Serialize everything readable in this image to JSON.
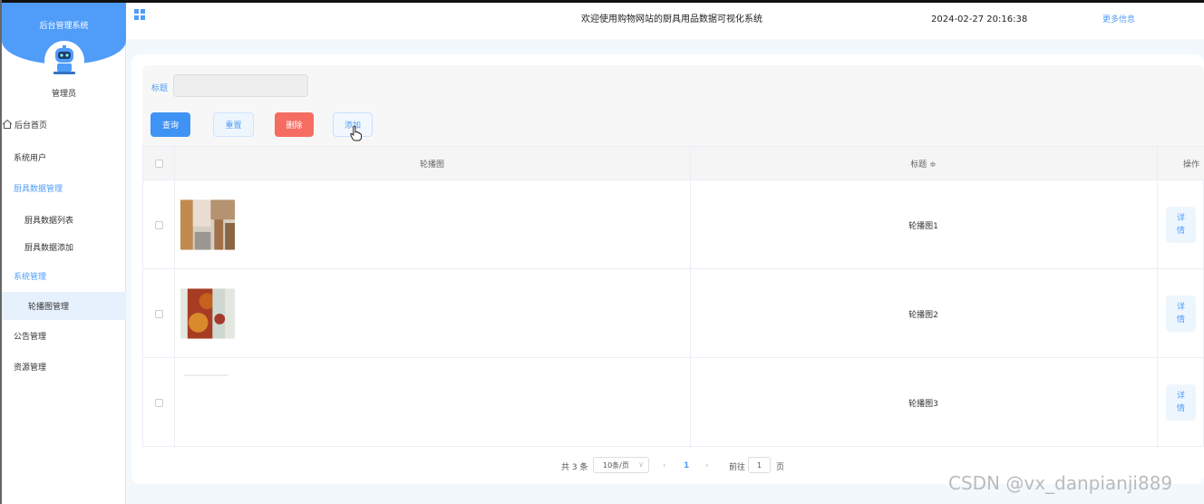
{
  "sidebar": {
    "title": "后台管理系统",
    "admin_name": "管理员",
    "items": [
      {
        "label": "后台首页",
        "icon": "home-icon"
      },
      {
        "label": "系统用户"
      },
      {
        "label": "厨具数据管理"
      },
      {
        "label": "厨具数据列表"
      },
      {
        "label": "厨具数据添加"
      },
      {
        "label": "系统管理"
      },
      {
        "label": "轮播图管理"
      },
      {
        "label": "公告管理"
      },
      {
        "label": "资源管理"
      }
    ]
  },
  "header": {
    "welcome": "欢迎使用购物网站的厨具用品数据可视化系统",
    "datetime": "2024-02-27 20:16:38",
    "more": "更多信息"
  },
  "search": {
    "label": "标题",
    "value": "",
    "buttons": {
      "query": "查询",
      "reset": "重置",
      "delete": "删除",
      "add": "添加"
    }
  },
  "table": {
    "columns": [
      "轮播图",
      "标题 ≑",
      "操作"
    ],
    "rows": [
      {
        "title": "轮播图1",
        "action": "详情"
      },
      {
        "title": "轮播图2",
        "action": "详情"
      },
      {
        "title": "轮播图3",
        "action": "详情"
      }
    ]
  },
  "pagination": {
    "total": "共 3 条",
    "page_size": "10条/页",
    "current": "1",
    "goto_label": "前往",
    "goto_value": "1",
    "page_unit": "页"
  },
  "colors": {
    "accent": "#4f9cf9",
    "danger": "#f56d62",
    "primary": "#3f93f5"
  },
  "watermark": "CSDN @vx_danpianji889"
}
